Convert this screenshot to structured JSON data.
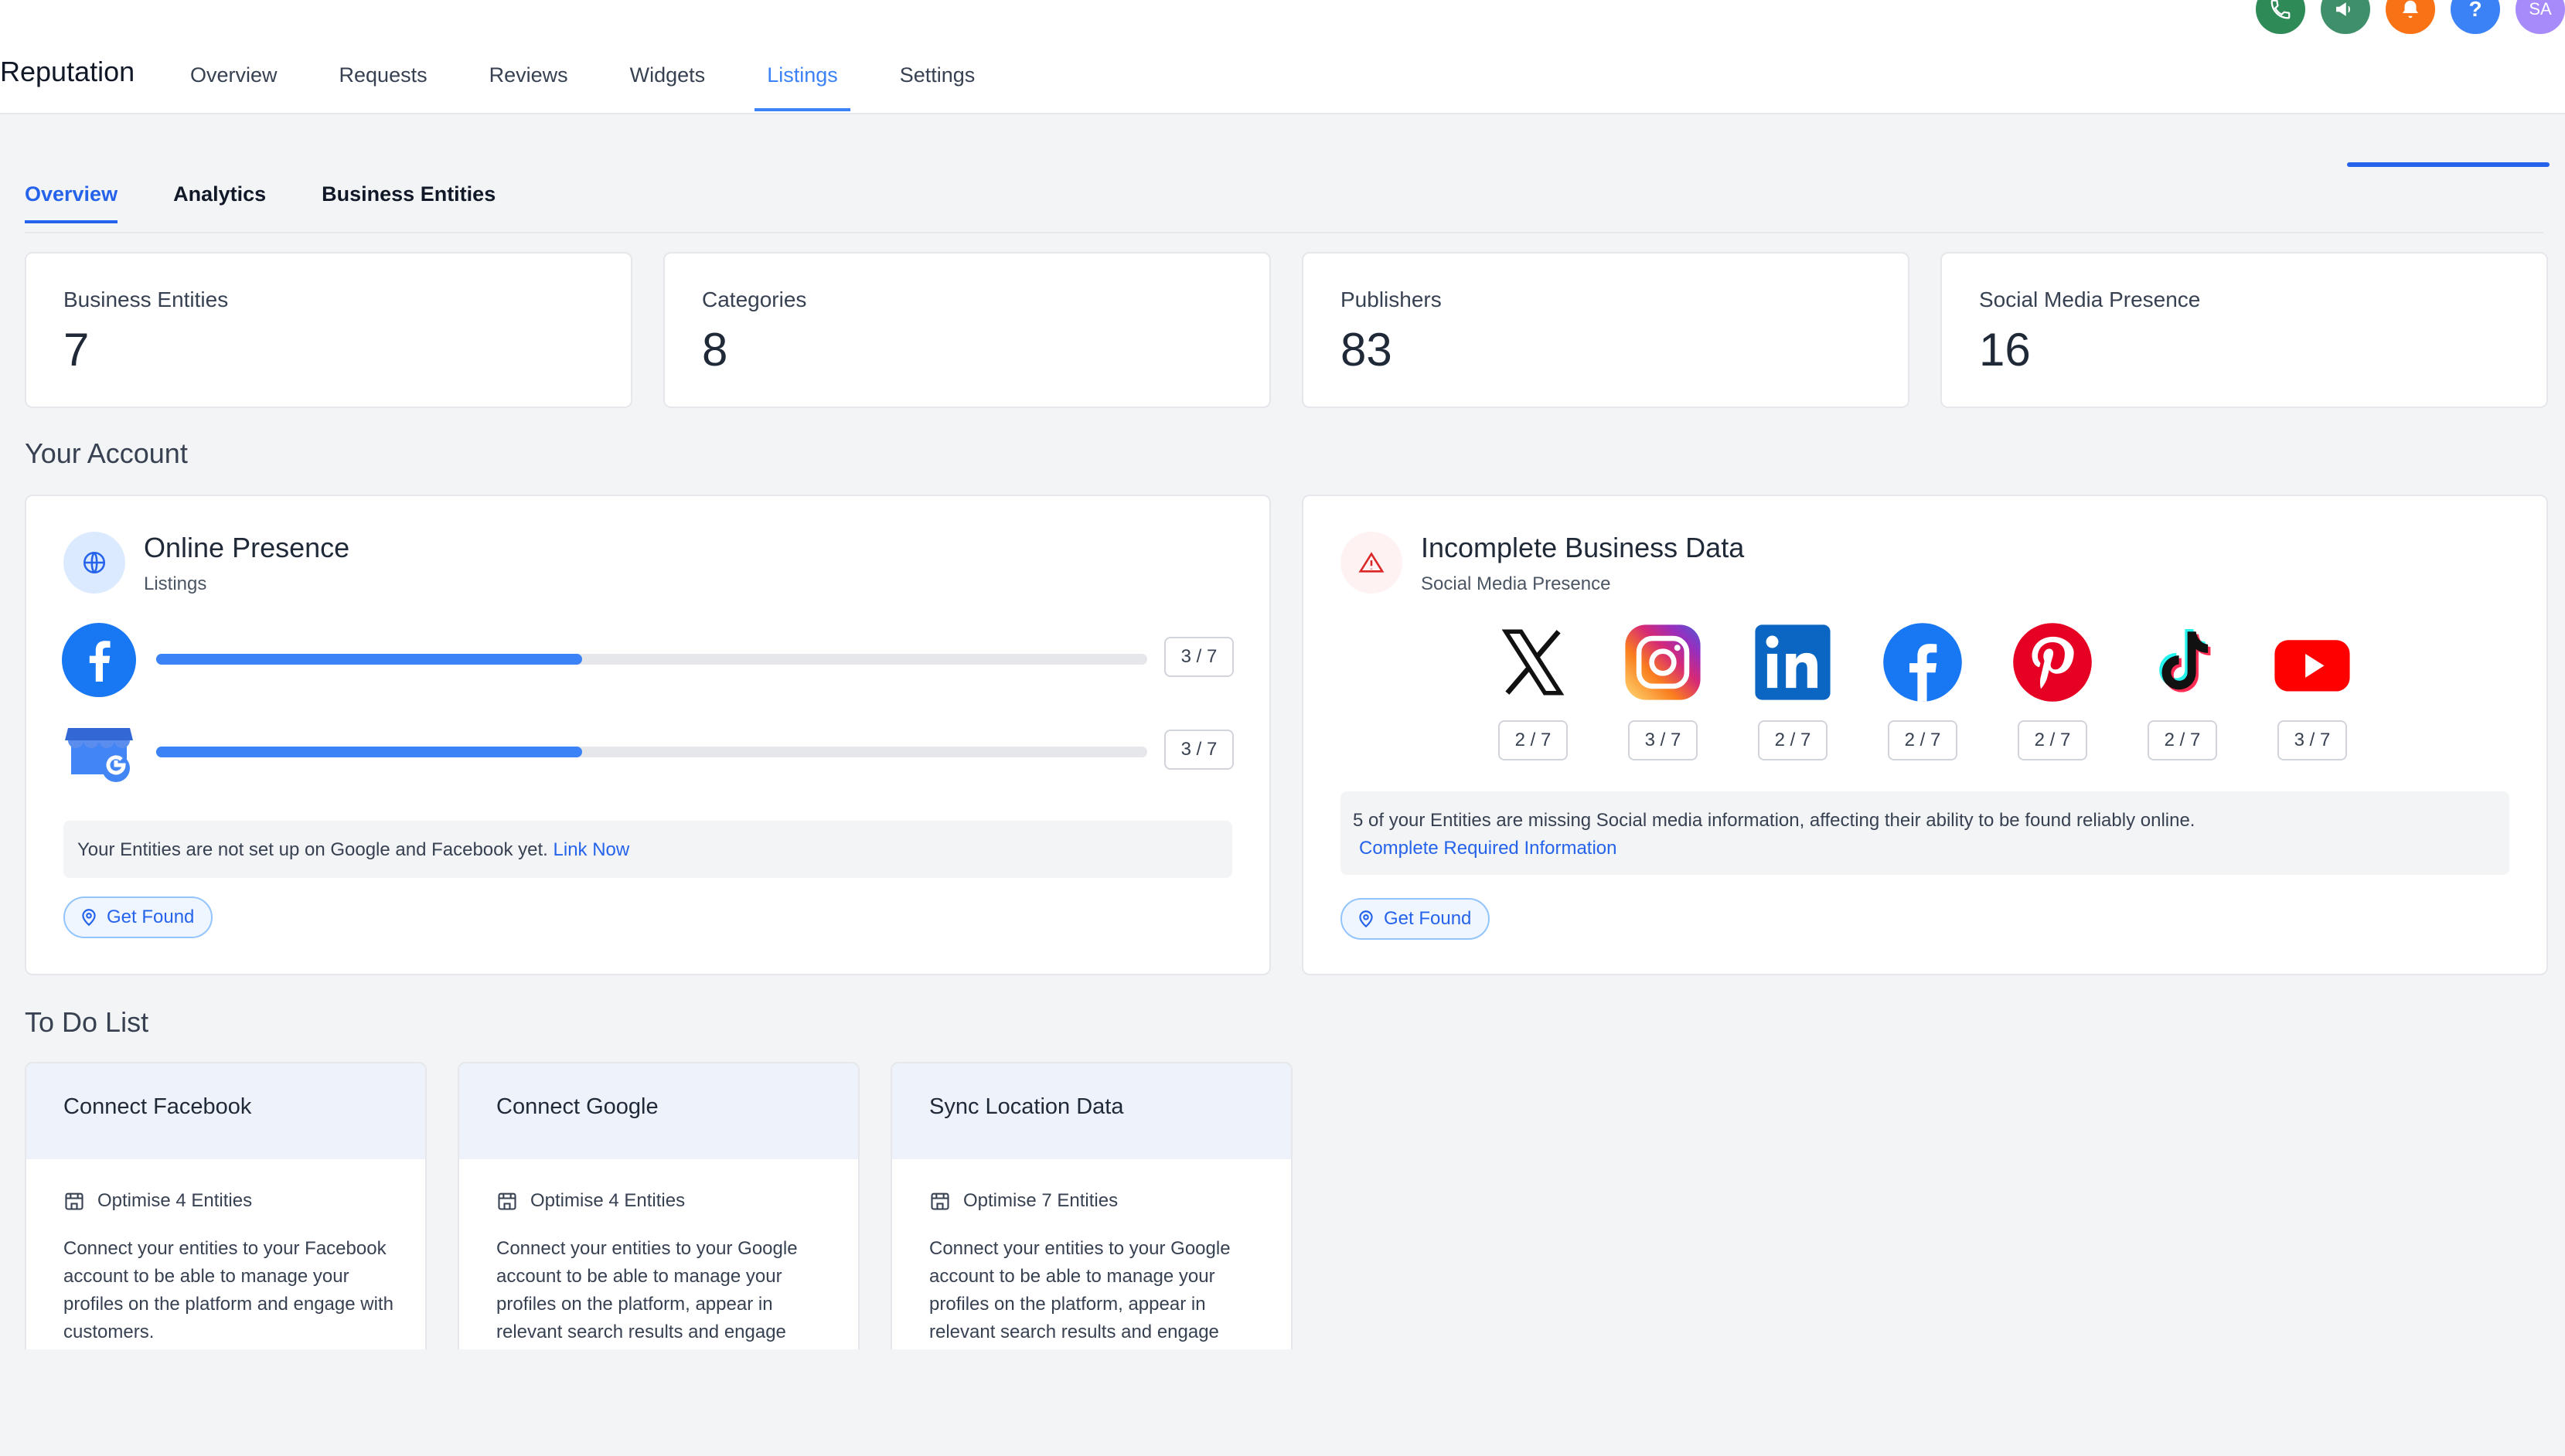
{
  "app": {
    "title": "Reputation",
    "nav": [
      "Overview",
      "Requests",
      "Reviews",
      "Widgets",
      "Listings",
      "Settings"
    ],
    "active_nav": "Listings",
    "avatar_initials": "SA",
    "help_symbol": "?"
  },
  "colors": {
    "accent": "#2563eb",
    "phone": "#2e8b57",
    "megaphone": "#3f8f6a",
    "bell": "#f97316",
    "help": "#3b82f6",
    "avatar": "#a78bfa"
  },
  "subtabs": [
    "Overview",
    "Analytics",
    "Business Entities"
  ],
  "stats": [
    {
      "label": "Business Entities",
      "value": "7"
    },
    {
      "label": "Categories",
      "value": "8"
    },
    {
      "label": "Publishers",
      "value": "83"
    },
    {
      "label": "Social Media Presence",
      "value": "16"
    }
  ],
  "your_account": {
    "title": "Your Account",
    "online_presence": {
      "title": "Online Presence",
      "subtitle": "Listings",
      "rows": [
        {
          "icon": "facebook-icon",
          "badge": "3 / 7",
          "progress": 0.43
        },
        {
          "icon": "google-business-icon",
          "badge": "3 / 7",
          "progress": 0.43
        }
      ],
      "notice": "Your Entities are not set up on Google and Facebook yet.",
      "notice_link": "Link Now",
      "button": "Get Found"
    },
    "incomplete_data": {
      "title": "Incomplete Business Data",
      "subtitle": "Social Media Presence",
      "socials": [
        {
          "icon": "x-icon",
          "badge": "2 / 7"
        },
        {
          "icon": "instagram-icon",
          "badge": "3 / 7"
        },
        {
          "icon": "linkedin-icon",
          "badge": "2 / 7"
        },
        {
          "icon": "facebook-icon",
          "badge": "2 / 7"
        },
        {
          "icon": "pinterest-icon",
          "badge": "2 / 7"
        },
        {
          "icon": "tiktok-icon",
          "badge": "2 / 7"
        },
        {
          "icon": "youtube-icon",
          "badge": "3 / 7"
        }
      ],
      "notice": "5 of your Entities are missing Social media information, affecting their ability to be found reliably online.",
      "notice_link": "Complete Required Information",
      "button": "Get Found"
    }
  },
  "todo": {
    "title": "To Do List",
    "cards": [
      {
        "title": "Connect Facebook",
        "meta": "Optimise 4 Entities",
        "desc": "Connect your entities to your Facebook account to be able to manage your profiles on the platform and engage with customers."
      },
      {
        "title": "Connect Google",
        "meta": "Optimise 4 Entities",
        "desc": "Connect your entities to your Google account to be able to manage your profiles on the platform, appear in relevant search results and engage"
      },
      {
        "title": "Sync Location Data",
        "meta": "Optimise 7 Entities",
        "desc": "Connect your entities to your Google account to be able to manage your profiles on the platform, appear in relevant search results and engage"
      }
    ]
  }
}
